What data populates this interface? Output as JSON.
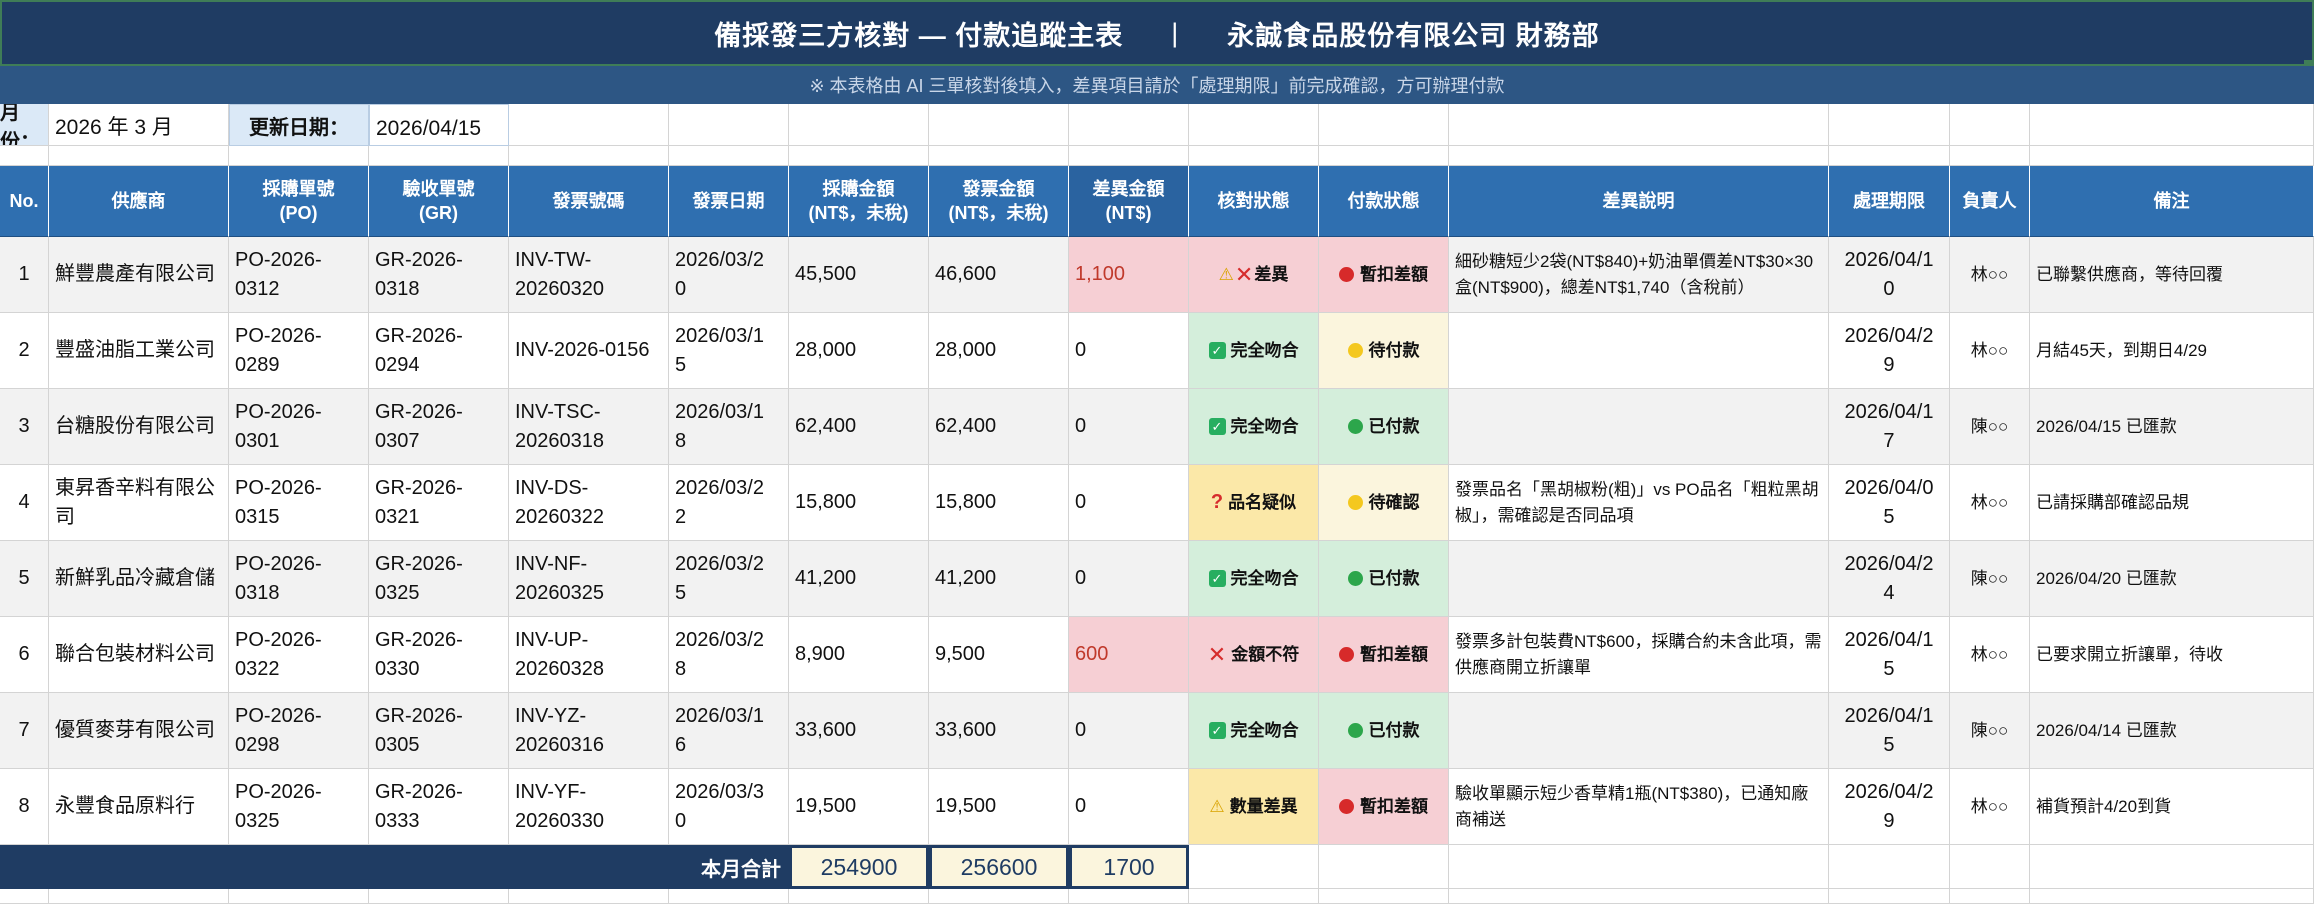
{
  "banner": {
    "title": "備採發三方核對 — 付款追蹤主表",
    "separator": "|",
    "company": "永誠食品股份有限公司 財務部"
  },
  "notice": "※ 本表格由 AI 三單核對後填入，差異項目請於「處理期限」前完成確認，方可辦理付款",
  "meta": {
    "month_label": "月份：",
    "month_value": "2026 年 3 月",
    "updated_label": "更新日期：",
    "updated_value": "2026/04/15"
  },
  "headers": {
    "no": "No.",
    "supplier": "供應商",
    "po": "採購單號\n(PO)",
    "gr": "驗收單號\n(GR)",
    "inv": "發票號碼",
    "inv_date": "發票日期",
    "po_amt": "採購金額\n(NT$，未稅)",
    "inv_amt": "發票金額\n(NT$，未稅)",
    "diff": "差異金額\n(NT$)",
    "match": "核對狀態",
    "pay": "付款狀態",
    "desc": "差異說明",
    "deadline": "處理期限",
    "owner": "負責人",
    "note": "備注"
  },
  "rows": [
    {
      "no": "1",
      "supplier": "鮮豐農產有限公司",
      "po": "PO-2026-\n0312",
      "gr": "GR-2026-\n0318",
      "inv": "INV-TW-\n20260320",
      "inv_date": "2026/03/2\n0",
      "po_amt": "45,500",
      "inv_amt": "46,600",
      "diff": "1,100",
      "match": "差異",
      "match_icons": [
        "warning-icon",
        "cross-icon"
      ],
      "match_tone": "red",
      "pay": "暫扣差額",
      "pay_dot": "red",
      "desc": "細砂糖短少2袋(NT$840)+奶油單價差NT$30×30盒(NT$900)，總差NT$1,740（含稅前）",
      "deadline": "2026/04/1\n0",
      "owner": "林○○",
      "note": "已聯繫供應商，等待回覆"
    },
    {
      "no": "2",
      "supplier": "豐盛油脂工業公司",
      "po": "PO-2026-\n0289",
      "gr": "GR-2026-\n0294",
      "inv": "INV-2026-0156",
      "inv_date": "2026/03/1\n5",
      "po_amt": "28,000",
      "inv_amt": "28,000",
      "diff": "0",
      "match": "完全吻合",
      "match_icons": [
        "check-icon"
      ],
      "match_tone": "green",
      "pay": "待付款",
      "pay_dot": "yellow",
      "desc": "",
      "deadline": "2026/04/2\n9",
      "owner": "林○○",
      "note": "月結45天，到期日4/29"
    },
    {
      "no": "3",
      "supplier": "台糖股份有限公司",
      "po": "PO-2026-\n0301",
      "gr": "GR-2026-\n0307",
      "inv": "INV-TSC-\n20260318",
      "inv_date": "2026/03/1\n8",
      "po_amt": "62,400",
      "inv_amt": "62,400",
      "diff": "0",
      "match": "完全吻合",
      "match_icons": [
        "check-icon"
      ],
      "match_tone": "green",
      "pay": "已付款",
      "pay_dot": "green",
      "desc": "",
      "deadline": "2026/04/1\n7",
      "owner": "陳○○",
      "note": "2026/04/15 已匯款"
    },
    {
      "no": "4",
      "supplier": "東昇香辛料有限公\n司",
      "po": "PO-2026-\n0315",
      "gr": "GR-2026-\n0321",
      "inv": "INV-DS-\n20260322",
      "inv_date": "2026/03/2\n2",
      "po_amt": "15,800",
      "inv_amt": "15,800",
      "diff": "0",
      "match": "品名疑似",
      "match_icons": [
        "question-icon"
      ],
      "match_tone": "yellow",
      "pay": "待確認",
      "pay_dot": "yellow",
      "desc": "發票品名「黑胡椒粉(粗)」vs PO品名「粗粒黑胡椒」，需確認是否同品項",
      "deadline": "2026/04/0\n5",
      "owner": "林○○",
      "note": "已請採購部確認品規"
    },
    {
      "no": "5",
      "supplier": "新鮮乳品冷藏倉儲",
      "po": "PO-2026-\n0318",
      "gr": "GR-2026-\n0325",
      "inv": "INV-NF-\n20260325",
      "inv_date": "2026/03/2\n5",
      "po_amt": "41,200",
      "inv_amt": "41,200",
      "diff": "0",
      "match": "完全吻合",
      "match_icons": [
        "check-icon"
      ],
      "match_tone": "green",
      "pay": "已付款",
      "pay_dot": "green",
      "desc": "",
      "deadline": "2026/04/2\n4",
      "owner": "陳○○",
      "note": "2026/04/20 已匯款"
    },
    {
      "no": "6",
      "supplier": "聯合包裝材料公司",
      "po": "PO-2026-\n0322",
      "gr": "GR-2026-\n0330",
      "inv": "INV-UP-\n20260328",
      "inv_date": "2026/03/2\n8",
      "po_amt": "8,900",
      "inv_amt": "9,500",
      "diff": "600",
      "match": "金額不符",
      "match_icons": [
        "cross-icon"
      ],
      "match_tone": "red",
      "pay": "暫扣差額",
      "pay_dot": "red",
      "desc": "發票多計包裝費NT$600，採購合約未含此項，需供應商開立折讓單",
      "deadline": "2026/04/1\n5",
      "owner": "林○○",
      "note": "已要求開立折讓單，待收"
    },
    {
      "no": "7",
      "supplier": "優質麥芽有限公司",
      "po": "PO-2026-\n0298",
      "gr": "GR-2026-\n0305",
      "inv": "INV-YZ-\n20260316",
      "inv_date": "2026/03/1\n6",
      "po_amt": "33,600",
      "inv_amt": "33,600",
      "diff": "0",
      "match": "完全吻合",
      "match_icons": [
        "check-icon"
      ],
      "match_tone": "green",
      "pay": "已付款",
      "pay_dot": "green",
      "desc": "",
      "deadline": "2026/04/1\n5",
      "owner": "陳○○",
      "note": "2026/04/14 已匯款"
    },
    {
      "no": "8",
      "supplier": "永豐食品原料行",
      "po": "PO-2026-\n0325",
      "gr": "GR-2026-\n0333",
      "inv": "INV-YF-\n20260330",
      "inv_date": "2026/03/3\n0",
      "po_amt": "19,500",
      "inv_amt": "19,500",
      "diff": "0",
      "match": "數量差異",
      "match_icons": [
        "warning-icon"
      ],
      "match_tone": "yellow",
      "pay": "暫扣差額",
      "pay_dot": "red",
      "desc": "驗收單顯示短少香草精1瓶(NT$380)，已通知廠商補送",
      "deadline": "2026/04/2\n9",
      "owner": "林○○",
      "note": "補貨預計4/20到貨"
    }
  ],
  "totals": {
    "label": "本月合計",
    "po_amt": "254900",
    "inv_amt": "256600",
    "diff": "1700"
  },
  "colors": {
    "banner_bg": "#1f3c63",
    "header_bg": "#2f6fb0",
    "red_fill": "#f6cfd4",
    "green_fill": "#d4eedb",
    "yellow_fill": "#fbe8a8",
    "cream_fill": "#fbf5dd"
  }
}
